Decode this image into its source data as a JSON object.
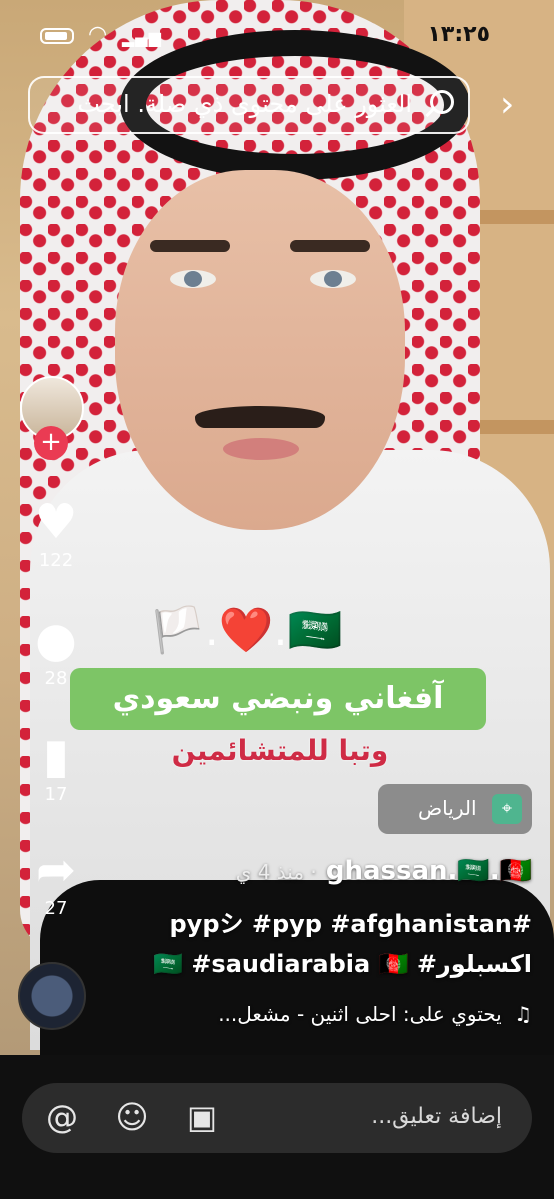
{
  "status_bar": {
    "time": "١٣:٢٥"
  },
  "search": {
    "placeholder": "العثور على محتوى ذي صلة. ابحث"
  },
  "actions": {
    "likes": "122",
    "comments": "28",
    "saves": "17",
    "shares": "27"
  },
  "video_text": {
    "emojis": "🏳️.❤️.🇸🇦",
    "caption_main": "آفغاني ونبضي سعودي",
    "caption_sub": "وتبا للمتشائمين"
  },
  "location": {
    "label": "الرياض"
  },
  "post": {
    "username": "ghassan.🇸🇦.🇦🇫",
    "time_ago": "منذ 4 ي",
    "hashtags_line1": "#pypシ #pyp #afghanistan",
    "hashtags_line2": "اكسبلور# 🇸🇦 #saudiarabia 🇦🇫",
    "music": "يحتوي على: احلى اثنين - مشعل..."
  },
  "comment_bar": {
    "placeholder": "إضافة تعليق..."
  },
  "icons": {
    "back": "chevron-right-icon",
    "search": "search-icon",
    "like": "heart-icon",
    "comment": "comment-icon",
    "save": "bookmark-icon",
    "share": "share-icon",
    "image": "image-icon",
    "emoji": "emoji-icon",
    "mention": "at-icon"
  }
}
